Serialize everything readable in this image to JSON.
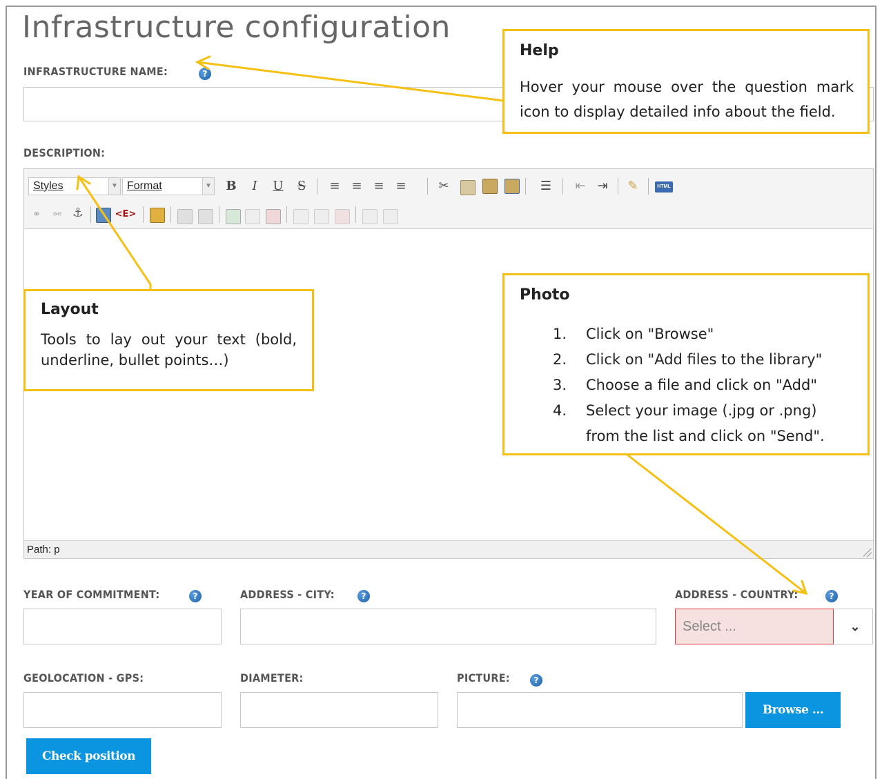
{
  "page": {
    "title": "Infrastructure configuration"
  },
  "fields": {
    "infrastructure_name": {
      "label": "INFRASTRUCTURE NAME:",
      "value": ""
    },
    "description": {
      "label": "DESCRIPTION:"
    },
    "year_of_commitment": {
      "label": "YEAR OF COMMITMENT:",
      "value": ""
    },
    "address_city": {
      "label": "ADDRESS - CITY:",
      "value": ""
    },
    "address_country": {
      "label": "ADDRESS - COUNTRY:",
      "selected": "Select ..."
    },
    "geolocation_gps": {
      "label": "GEOLOCATION - GPS:",
      "value": ""
    },
    "diameter": {
      "label": "DIAMETER:",
      "value": ""
    },
    "picture": {
      "label": "PICTURE:",
      "value": ""
    }
  },
  "editor": {
    "styles_label": "Styles",
    "format_label": "Format",
    "bold": "B",
    "italic": "I",
    "underline": "U",
    "strike": "S",
    "html_label": "HTML",
    "special_char": "<E>",
    "path_label": "Path: p"
  },
  "buttons": {
    "browse": "Browse ...",
    "check_position": "Check position"
  },
  "help_icon_glyph": "?",
  "callouts": {
    "help": {
      "title": "Help",
      "text": "Hover your mouse over the question mark icon to display detailed info about the field."
    },
    "layout": {
      "title": "Layout",
      "text": "Tools to lay out your text (bold, underline, bullet points…)"
    },
    "photo": {
      "title": "Photo",
      "steps": [
        {
          "num": "1.",
          "text": "Click on \"Browse\""
        },
        {
          "num": "2.",
          "text": "Click on \"Add files to the library\""
        },
        {
          "num": "3.",
          "text": "Choose a file and click on \"Add\""
        },
        {
          "num": "4.",
          "text": "Select your image (.jpg or .png) from the list and click on \"Send\"."
        }
      ]
    }
  },
  "colors": {
    "accent_blue": "#0b94e0",
    "callout_border": "#f5c013",
    "error_border": "#e23b3b",
    "error_bg": "#f6e0e0"
  }
}
